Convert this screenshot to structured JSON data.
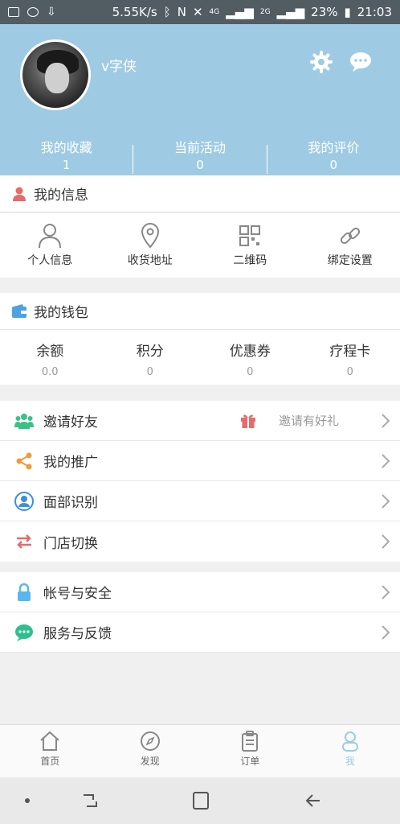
{
  "status_bar": {
    "network_speed": "5.55K/s",
    "signal_a": "4G",
    "signal_b": "2G",
    "battery": "23%",
    "time": "21:03"
  },
  "profile": {
    "username": "v字侠"
  },
  "stats": [
    {
      "label": "我的收藏",
      "value": "1"
    },
    {
      "label": "当前活动",
      "value": "0"
    },
    {
      "label": "我的评价",
      "value": "0"
    }
  ],
  "my_info": {
    "title": "我的信息",
    "items": [
      {
        "label": "个人信息",
        "icon": "person-icon"
      },
      {
        "label": "收货地址",
        "icon": "location-pin-icon"
      },
      {
        "label": "二维码",
        "icon": "qr-code-icon"
      },
      {
        "label": "绑定设置",
        "icon": "link-icon"
      }
    ]
  },
  "wallet": {
    "title": "我的钱包",
    "items": [
      {
        "label": "余额",
        "value": "0.0"
      },
      {
        "label": "积分",
        "value": "0"
      },
      {
        "label": "优惠券",
        "value": "0"
      },
      {
        "label": "疗程卡",
        "value": "0"
      }
    ]
  },
  "list_group_1": [
    {
      "label": "邀请好友",
      "icon": "group-icon",
      "extra": "邀请有好礼"
    },
    {
      "label": "我的推广",
      "icon": "share-icon"
    },
    {
      "label": "面部识别",
      "icon": "face-id-icon"
    },
    {
      "label": "门店切换",
      "icon": "swap-icon"
    }
  ],
  "list_group_2": [
    {
      "label": "帐号与安全",
      "icon": "lock-icon"
    },
    {
      "label": "服务与反馈",
      "icon": "chat-bubble-icon"
    }
  ],
  "tabbar": [
    {
      "label": "首页",
      "icon": "home-icon"
    },
    {
      "label": "发现",
      "icon": "compass-icon"
    },
    {
      "label": "订单",
      "icon": "clipboard-icon"
    },
    {
      "label": "我",
      "icon": "user-icon",
      "active": true
    }
  ],
  "colors": {
    "header_bg": "#9ecbe3",
    "accent": "#9ecbe3",
    "status_bar": "#525c63"
  }
}
